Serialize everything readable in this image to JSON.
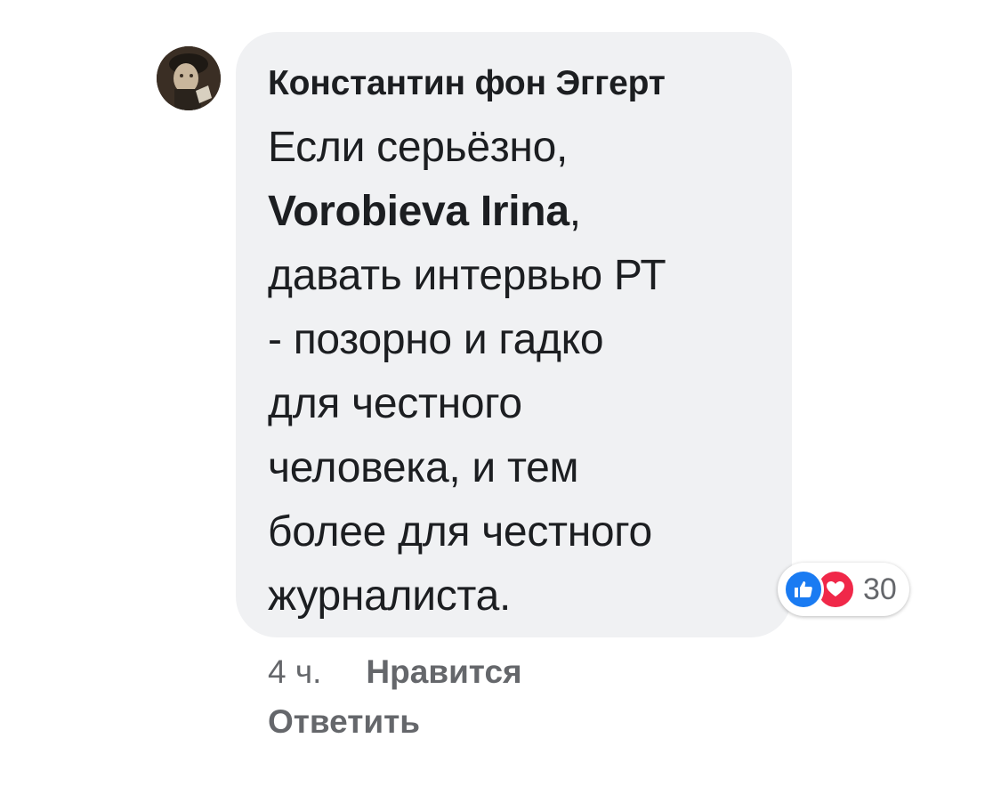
{
  "comment": {
    "author": "Константин фон Эггерт",
    "lines": [
      {
        "text": "Если серьёзно,"
      },
      {
        "mention": "Vorobieva Irina",
        "suffix": ","
      },
      {
        "text": "давать интервью РТ"
      },
      {
        "text": "- позорно и гадко"
      },
      {
        "text": "для честного"
      },
      {
        "text": "человека, и тем"
      },
      {
        "text": "более для честного"
      },
      {
        "text": "журналиста."
      }
    ],
    "reactions": {
      "icons": [
        "like-icon",
        "love-icon"
      ],
      "count": "30",
      "colors": {
        "like": "#1a7bf2",
        "love": "#f02849"
      }
    },
    "time": "4 ч.",
    "like_label": "Нравится",
    "reply_label": "Ответить"
  }
}
